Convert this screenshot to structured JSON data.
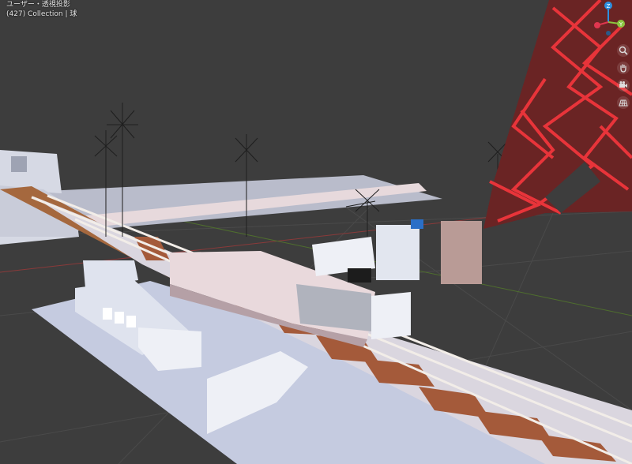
{
  "viewport": {
    "title": "ユーザー・透視投影",
    "subtitle": "(427) Collection | 球"
  },
  "gizmo": {
    "z_label": "Z",
    "y_label": "Y",
    "x_color": "#e0364f",
    "y_color": "#8bc540",
    "z_color": "#2c8fe0"
  },
  "nav_buttons": [
    {
      "name": "zoom-icon"
    },
    {
      "name": "hand-pan-icon"
    },
    {
      "name": "camera-view-icon"
    },
    {
      "name": "ortho-grid-icon"
    }
  ],
  "colors": {
    "background": "#3d3d3d",
    "wire_red": "#e8343a",
    "tower_fill": "#6a2424",
    "model_light": "#dfe3ee",
    "model_shadow": "#c8ccd9",
    "rail_brown": "#8a4a33"
  }
}
